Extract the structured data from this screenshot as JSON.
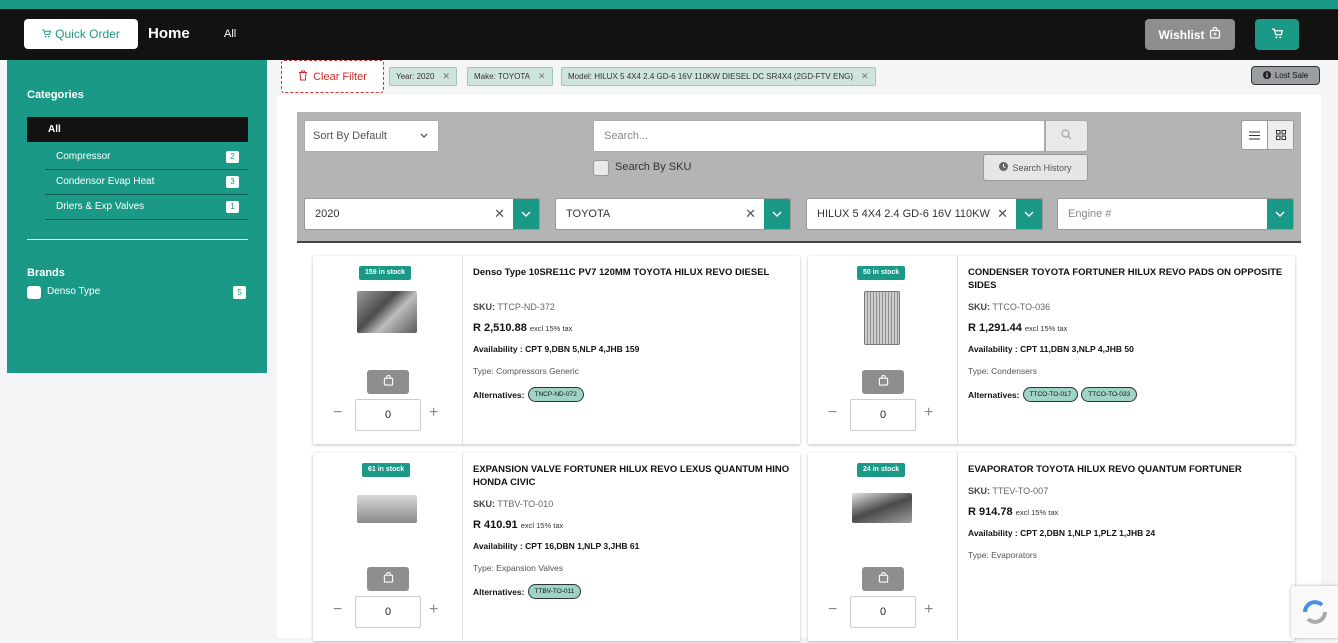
{
  "header": {
    "quick_order_label": "Quick Order",
    "title": "Home",
    "all_link": "All",
    "wishlist_label": "Wishlist"
  },
  "sidebar": {
    "categories_heading": "Categories",
    "all_label": "All",
    "categories": [
      {
        "label": "Compressor",
        "count": "2"
      },
      {
        "label": "Condensor Evap Heat",
        "count": "3"
      },
      {
        "label": "Driers & Exp Valves",
        "count": "1"
      }
    ],
    "brands_heading": "Brands",
    "brands": [
      {
        "label": "Denso Type",
        "count": "5"
      }
    ]
  },
  "filters": {
    "clear_label": "Clear Filter",
    "chips": [
      "Year: 2020",
      "Make: TOYOTA",
      "Model: HILUX 5 4X4 2.4 GD-6 16V 110KW DIESEL DC SR4X4 (2GD-FTV ENG)"
    ],
    "lost_sale_label": "Lost Sale"
  },
  "toolbar": {
    "sort_label": "Sort By Default",
    "search_placeholder": "Search...",
    "search_by_sku_label": "Search By SKU",
    "search_history_label": "Search History",
    "year_value": "2020",
    "make_value": "TOYOTA",
    "model_value": "HILUX 5 4X4 2.4 GD-6 16V 110KW",
    "engine_placeholder": "Engine #"
  },
  "labels": {
    "sku": "SKU:",
    "excl_tax": "excl 15% tax",
    "availability": "Availability :",
    "type": "Type:",
    "alternatives": "Alternatives:",
    "minus": "−",
    "plus": "+"
  },
  "products": [
    {
      "stock": "159 in stock",
      "title": "Denso Type 10SRE11C PV7 120MM TOYOTA HILUX REVO DIESEL",
      "sku": "TTCP-ND-372",
      "price": "R 2,510.88",
      "availability": "CPT 9,DBN 5,NLP 4,JHB 159",
      "type": "Compressors Generic",
      "alternatives": [
        "TNCP-ND-072"
      ],
      "qty": "0"
    },
    {
      "stock": "50 in stock",
      "title": "CONDENSER TOYOTA FORTUNER HILUX REVO PADS ON OPPOSITE SIDES",
      "sku": "TTCO-TO-036",
      "price": "R 1,291.44",
      "availability": "CPT 11,DBN 3,NLP 4,JHB 50",
      "type": "Condensers",
      "alternatives": [
        "TTCO-TO-017",
        "TTCO-TO-033"
      ],
      "qty": "0"
    },
    {
      "stock": "61 in stock",
      "title": "EXPANSION VALVE FORTUNER HILUX REVO LEXUS QUANTUM HINO HONDA CIVIC",
      "sku": "TTBV-TO-010",
      "price": "R 410.91",
      "availability": "CPT 16,DBN 1,NLP 3,JHB 61",
      "type": "Expansion Valves",
      "alternatives": [
        "TTBV-TO-011"
      ],
      "qty": "0"
    },
    {
      "stock": "24 in stock",
      "title": "EVAPORATOR TOYOTA HILUX REVO QUANTUM FORTUNER",
      "sku": "TTEV-TO-007",
      "price": "R 914.78",
      "availability": "CPT 2,DBN 1,NLP 1,PLZ 1,JHB 24",
      "type": "Evaporators",
      "alternatives": [],
      "qty": "0"
    }
  ],
  "colors": {
    "accent": "#1a9a86",
    "topbar": "#121212",
    "danger": "#cc2a2a"
  }
}
